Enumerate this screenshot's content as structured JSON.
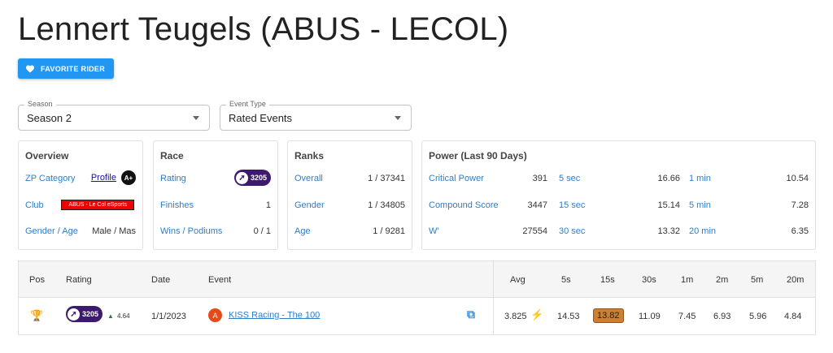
{
  "page": {
    "title": "Lennert Teugels (ABUS - LECOL)"
  },
  "favorite_button": {
    "label": "FAVORITE RIDER",
    "icon": "heart-icon",
    "color": "#2196f3"
  },
  "filters": {
    "season": {
      "label": "Season",
      "value": "Season 2"
    },
    "event_type": {
      "label": "Event Type",
      "value": "Rated Events"
    }
  },
  "overview": {
    "heading": "Overview",
    "zp_category_label": "ZP Category",
    "profile_link": "Profile",
    "category_badge": "A+",
    "club_label": "Club",
    "club_value": "ABUS - Le Col eSports",
    "gender_age_label": "Gender / Age",
    "gender_age_value": "Male / Mas"
  },
  "race": {
    "heading": "Race",
    "rating_label": "Rating",
    "rating_value": "3205",
    "finishes_label": "Finishes",
    "finishes_value": "1",
    "wins_label": "Wins / Podiums",
    "wins_value": "0 / 1"
  },
  "ranks": {
    "heading": "Ranks",
    "overall_label": "Overall",
    "overall_value": "1 / 37341",
    "gender_label": "Gender",
    "gender_value": "1 / 34805",
    "age_label": "Age",
    "age_value": "1 / 9281"
  },
  "power": {
    "heading": "Power (Last 90 Days)",
    "rows": [
      {
        "label": "Critical Power",
        "value": "391",
        "d1": "5 sec",
        "v1": "16.66",
        "d2": "1 min",
        "v2": "10.54"
      },
      {
        "label": "Compound Score",
        "value": "3447",
        "d1": "15 sec",
        "v1": "15.14",
        "d2": "5 min",
        "v2": "7.28"
      },
      {
        "label": "W'",
        "value": "27554",
        "d1": "30 sec",
        "v1": "13.32",
        "d2": "20 min",
        "v2": "6.35"
      }
    ]
  },
  "table": {
    "headers": {
      "pos": "Pos",
      "rating": "Rating",
      "date": "Date",
      "event": "Event",
      "avg": "Avg",
      "s5": "5s",
      "s15": "15s",
      "s30": "30s",
      "m1": "1m",
      "m2": "2m",
      "m5": "5m",
      "m20": "20m"
    },
    "row": {
      "pos_icon": "trophy-icon",
      "rating": "3205",
      "rating_change": "4.64",
      "date": "1/1/2023",
      "event_category": "A",
      "event_name": "KISS Racing - The 100",
      "avg": "3.825",
      "s5": "14.53",
      "s15": "13.82",
      "s30": "11.09",
      "m1": "7.45",
      "m2": "6.93",
      "m5": "5.96",
      "m20": "4.84"
    }
  }
}
